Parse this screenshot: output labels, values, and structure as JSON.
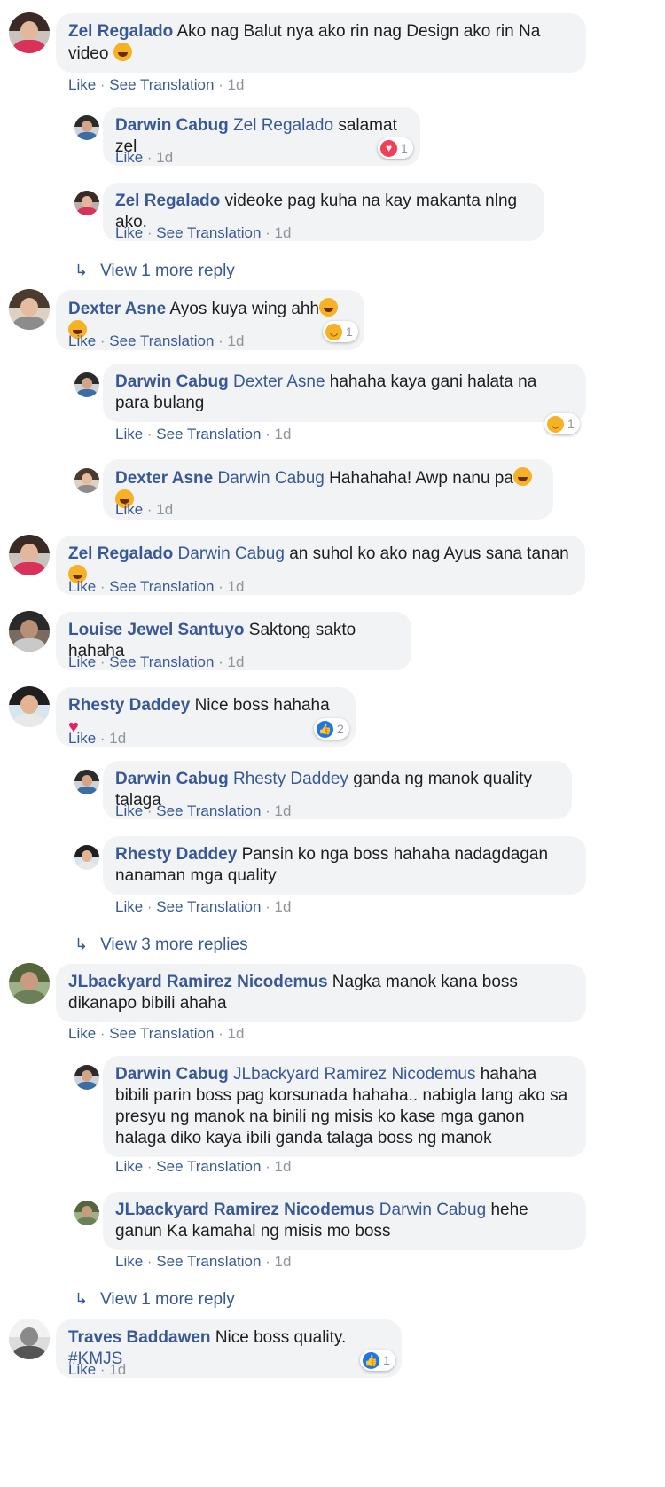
{
  "meta": {
    "like": "Like",
    "see_translation": "See Translation",
    "sep": " · ",
    "time": "1d"
  },
  "c1": {
    "name": "Zel Regalado",
    "text": "Ako nag Balut nya ako rin nag Design ako rin Na video"
  },
  "c1r1": {
    "name": "Darwin Cabug",
    "tag": "Zel Regalado",
    "text": "salamat zel",
    "react_count": "1"
  },
  "c1r2": {
    "name": "Zel Regalado",
    "text": "videoke pag kuha na kay makanta nlng ako."
  },
  "c1more": "View 1 more reply",
  "c2": {
    "name": "Dexter Asne",
    "text": "Ayos kuya wing ahh",
    "react_count": "1"
  },
  "c2r1": {
    "name": "Darwin Cabug",
    "tag": "Dexter Asne",
    "text": "hahaha kaya gani halata na para bulang",
    "react_count": "1"
  },
  "c2r2": {
    "name": "Dexter Asne",
    "tag": "Darwin Cabug",
    "text": "Hahahaha! Awp nanu pa"
  },
  "c3": {
    "name": "Zel Regalado",
    "tag": "Darwin Cabug",
    "text": "an suhol ko ako nag Ayus sana tanan"
  },
  "c4": {
    "name": "Louise Jewel Santuyo",
    "text": "Saktong sakto hahaha"
  },
  "c5": {
    "name": "Rhesty Daddey",
    "text": "Nice boss hahaha",
    "react_count": "2"
  },
  "c5r1": {
    "name": "Darwin Cabug",
    "tag": "Rhesty Daddey",
    "text": "ganda ng manok quality talaga"
  },
  "c5r2": {
    "name": "Rhesty Daddey",
    "text": "Pansin ko nga boss hahaha nadagdagan nanaman mga quality"
  },
  "c5more": "View 3 more replies",
  "c6": {
    "name": "JLbackyard Ramirez Nicodemus",
    "text": "Nagka manok kana boss dikanapo bibili ahaha"
  },
  "c6r1": {
    "name": "Darwin Cabug",
    "tag": "JLbackyard Ramirez Nicodemus",
    "text": "hahaha bibili parin boss pag korsunada hahaha.. nabigla lang ako sa presyu ng manok na binili ng misis ko kase mga ganon halaga diko kaya ibili ganda talaga boss ng manok"
  },
  "c6r2": {
    "name": "JLbackyard Ramirez Nicodemus",
    "tag": "Darwin Cabug",
    "text": "hehe ganun Ka kamahal ng misis mo boss"
  },
  "c6more": "View 1 more reply",
  "c7": {
    "name": "Traves Baddawen",
    "text": "Nice boss quality.",
    "hashtag": "#KMJS",
    "react_count": "1"
  },
  "colors": {
    "link": "#385898",
    "bubble": "#f2f3f5",
    "meta_gray": "#90949c"
  }
}
